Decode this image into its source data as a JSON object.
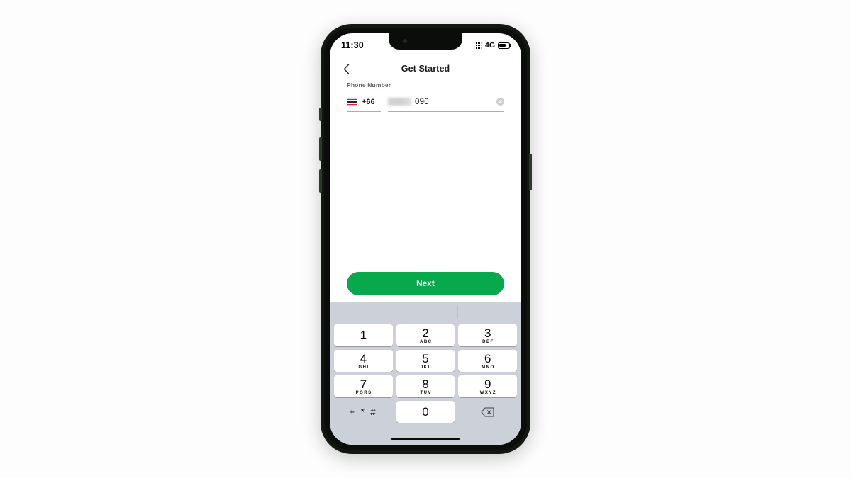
{
  "status_bar": {
    "time": "11:30",
    "network_type": "4G",
    "signal_icon": "signal-dots-icon",
    "battery_icon": "battery-icon",
    "battery_level_pct": 58
  },
  "nav": {
    "back_icon": "chevron-left-icon",
    "title": "Get Started"
  },
  "form": {
    "field_label": "Phone Number",
    "country_code": "+66",
    "country_flag": "thailand-flag-icon",
    "redacted_digits": "",
    "visible_digits": "090",
    "clear_icon": "clear-circle-icon",
    "caret_color": "#00b14f"
  },
  "primary_action": {
    "label": "Next",
    "color": "#07a94c"
  },
  "keyboard": {
    "background": "#ccd0d8",
    "predictive_bar_empty": true,
    "rows": [
      [
        {
          "digit": "1",
          "letters": ""
        },
        {
          "digit": "2",
          "letters": "ABC"
        },
        {
          "digit": "3",
          "letters": "DEF"
        }
      ],
      [
        {
          "digit": "4",
          "letters": "GHI"
        },
        {
          "digit": "5",
          "letters": "JKL"
        },
        {
          "digit": "6",
          "letters": "MNO"
        }
      ],
      [
        {
          "digit": "7",
          "letters": "PQRS"
        },
        {
          "digit": "8",
          "letters": "TUV"
        },
        {
          "digit": "9",
          "letters": "WXYZ"
        }
      ]
    ],
    "symbol_key": "+ * #",
    "zero_key": "0",
    "backspace_icon": "backspace-icon"
  }
}
